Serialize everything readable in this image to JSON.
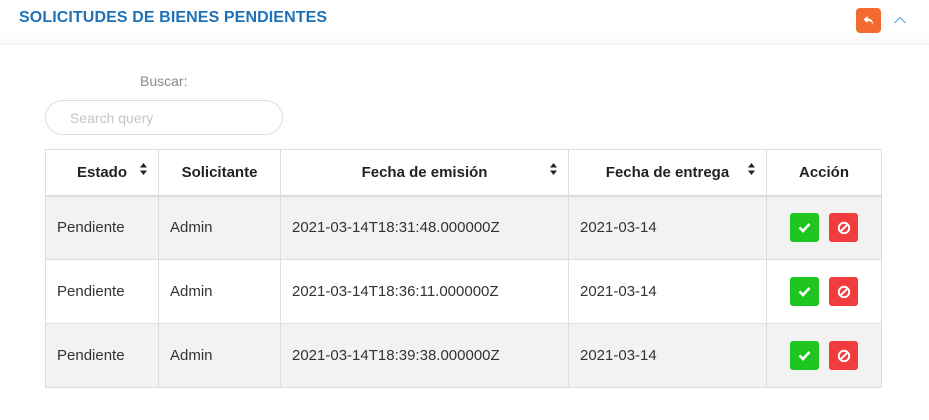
{
  "panel": {
    "title": "SOLICITUDES DE BIENES PENDIENTES",
    "icons": {
      "undo": "undo-icon",
      "collapse": "chevron-up-icon"
    },
    "colors": {
      "title": "#1f72b8",
      "undo_button": "#f26a2e",
      "approve": "#1ec51e",
      "reject": "#f03c3c"
    }
  },
  "search": {
    "label": "Buscar:",
    "placeholder": "Search query",
    "value": ""
  },
  "table": {
    "columns": [
      "Estado",
      "Solicitante",
      "Fecha de emisión",
      "Fecha de entrega",
      "Acción"
    ],
    "sortable": [
      true,
      false,
      true,
      true,
      false
    ],
    "rows": [
      {
        "estado": "Pendiente",
        "solicitante": "Admin",
        "fecha_emision": "2021-03-14T18:31:48.000000Z",
        "fecha_entrega": "2021-03-14"
      },
      {
        "estado": "Pendiente",
        "solicitante": "Admin",
        "fecha_emision": "2021-03-14T18:36:11.000000Z",
        "fecha_entrega": "2021-03-14"
      },
      {
        "estado": "Pendiente",
        "solicitante": "Admin",
        "fecha_emision": "2021-03-14T18:39:38.000000Z",
        "fecha_entrega": "2021-03-14"
      }
    ],
    "row_actions": {
      "approve_icon": "check-icon",
      "reject_icon": "ban-icon"
    }
  }
}
